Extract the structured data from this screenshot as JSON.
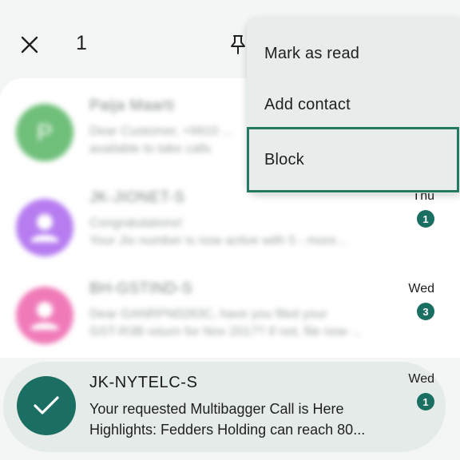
{
  "appbar": {
    "selected_count": "1"
  },
  "menu": {
    "items": [
      {
        "label": "Mark as read"
      },
      {
        "label": "Add contact"
      },
      {
        "label": "Block"
      }
    ]
  },
  "conversations": [
    {
      "sender": "Paija Maarti",
      "preview_line1": "Dear Customer, +9910 ...",
      "preview_line2": "available to take calls",
      "time": "",
      "unread": "",
      "avatar_color": "#6fbf7a"
    },
    {
      "sender": "JK-JIONET-S",
      "preview_line1": "Congratulations!",
      "preview_line2": "Your Jio number is now active with 5 - more...",
      "time": "Thu",
      "unread": "1",
      "avatar_color": "#b67cf0"
    },
    {
      "sender": "BH-GSTIND-S",
      "preview_line1": "Dear GANRPN0283C, have you filed your",
      "preview_line2": "GST-R3B return for Nov 2017? If not, file now ...",
      "time": "Wed",
      "unread": "3",
      "avatar_color": "#f07ab8"
    }
  ],
  "selected_conversation": {
    "sender": "JK-NYTELC-S",
    "preview_line1": "Your requested Multibagger Call is Here",
    "preview_line2": "Highlights: Fedders Holding can reach 80...",
    "time": "Wed",
    "unread": "1"
  },
  "colors": {
    "accent": "#1a6e62",
    "menu_highlight_border": "#237a61",
    "selected_row_bg": "#e4ebe8"
  }
}
